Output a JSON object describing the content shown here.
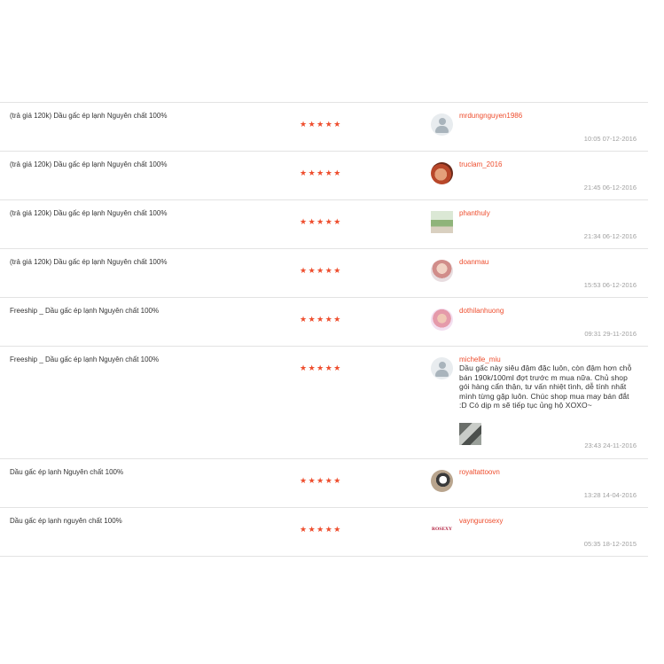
{
  "reviews": [
    {
      "product": "(trả giá 120k) Dầu gấc ép lạnh Nguyên chất 100%",
      "stars": "★★★★★",
      "rating": 5,
      "avatar": "default-user-icon",
      "username": "mrdungnguyen1986",
      "comment": "",
      "time": "10:05 07-12-2016"
    },
    {
      "product": "(trả giá 120k) Dầu gấc ép lạnh Nguyên chất 100%",
      "stars": "★★★★★",
      "rating": 5,
      "avatar": "user-photo",
      "username": "truclam_2016",
      "comment": "",
      "time": "21:45 06-12-2016"
    },
    {
      "product": "(trả giá 120k) Dầu gấc ép lạnh Nguyên chất 100%",
      "stars": "★★★★★",
      "rating": 5,
      "avatar": "user-photo",
      "username": "phanthuly",
      "comment": "",
      "time": "21:34 06-12-2016"
    },
    {
      "product": "(trả giá 120k) Dầu gấc ép lạnh Nguyên chất 100%",
      "stars": "★★★★★",
      "rating": 5,
      "avatar": "user-photo",
      "username": "doanmau",
      "comment": "",
      "time": "15:53 06-12-2016"
    },
    {
      "product": "Freeship _ Dầu gấc ép lạnh Nguyên chất 100%",
      "stars": "★★★★★",
      "rating": 5,
      "avatar": "user-photo",
      "username": "dothilanhuong",
      "comment": "",
      "time": "09:31 29-11-2016"
    },
    {
      "product": "Freeship _ Dầu gấc ép lạnh Nguyên chất 100%",
      "stars": "★★★★★",
      "rating": 5,
      "avatar": "default-user-icon",
      "username": "michelle_miu",
      "comment": "Dầu gấc này siêu đậm đặc luôn, còn đậm hơn chỗ bán 190k/100ml đợt trước m mua nữa. Chủ shop gói hàng cẩn thận, tư vấn nhiệt tình, dễ tính nhất mình từng gặp luôn. Chúc shop mua may bán đắt :D Có dịp m sẽ tiếp tục ủng hộ XOXO~",
      "time": "23:43 24-11-2016"
    },
    {
      "product": "Dầu gấc ép lạnh Nguyên chất 100%",
      "stars": "★★★★★",
      "rating": 5,
      "avatar": "user-photo",
      "username": "royaltattoovn",
      "comment": "",
      "time": "13:28 14-04-2016"
    },
    {
      "product": "Dầu gấc ép lạnh nguyên chất 100%",
      "stars": "★★★★★",
      "rating": 5,
      "avatar": "brand-logo",
      "logo_text": "ROSEXY",
      "username": "vayngurosexy",
      "comment": "",
      "time": "05:35 18-12-2015"
    }
  ]
}
